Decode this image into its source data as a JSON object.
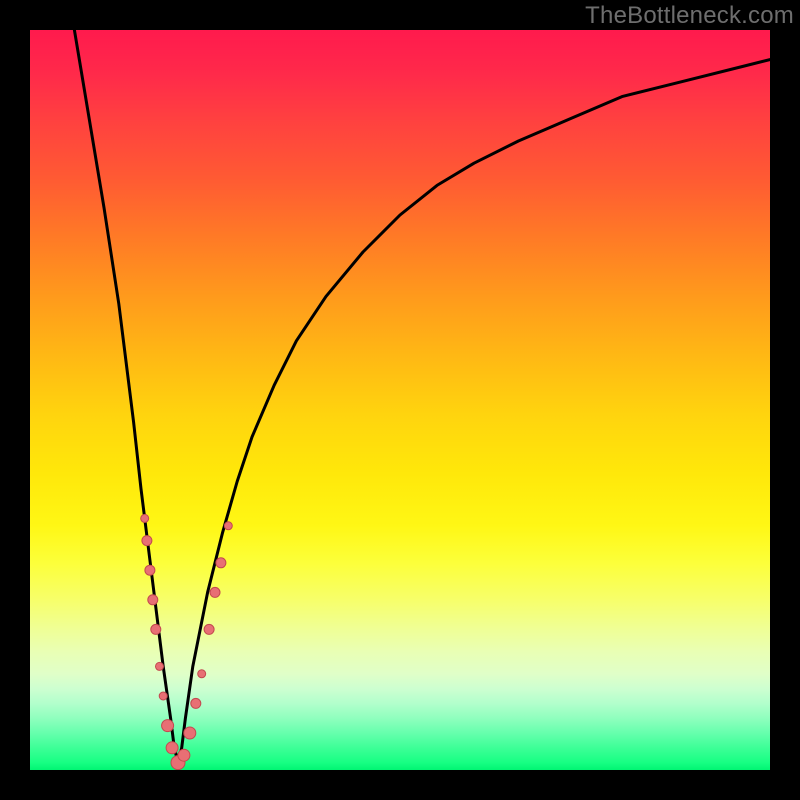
{
  "watermark": "TheBottleneck.com",
  "colors": {
    "curve_stroke": "#000000",
    "point_fill": "#e86f74",
    "point_stroke": "#c3494f"
  },
  "chart_data": {
    "type": "line",
    "title": "",
    "xlabel": "",
    "ylabel": "",
    "xlim": [
      0,
      100
    ],
    "ylim": [
      0,
      100
    ],
    "grid": false,
    "legend": false,
    "series": [
      {
        "name": "bottleneck-curve",
        "x": [
          6,
          8,
          10,
          12,
          14,
          15,
          16,
          17,
          18,
          19,
          19.5,
          20,
          20.5,
          21,
          22,
          24,
          26,
          28,
          30,
          33,
          36,
          40,
          45,
          50,
          55,
          60,
          66,
          73,
          80,
          88,
          96,
          100
        ],
        "y": [
          100,
          88,
          76,
          63,
          47,
          38,
          30,
          22,
          14,
          7,
          3,
          1,
          3,
          7,
          14,
          24,
          32,
          39,
          45,
          52,
          58,
          64,
          70,
          75,
          79,
          82,
          85,
          88,
          91,
          93,
          95,
          96
        ]
      }
    ],
    "points": [
      {
        "x": 15.5,
        "y": 34,
        "r": 4
      },
      {
        "x": 15.8,
        "y": 31,
        "r": 5
      },
      {
        "x": 16.2,
        "y": 27,
        "r": 5
      },
      {
        "x": 16.6,
        "y": 23,
        "r": 5
      },
      {
        "x": 17.0,
        "y": 19,
        "r": 5
      },
      {
        "x": 17.5,
        "y": 14,
        "r": 4
      },
      {
        "x": 18.0,
        "y": 10,
        "r": 4
      },
      {
        "x": 18.6,
        "y": 6,
        "r": 6
      },
      {
        "x": 19.2,
        "y": 3,
        "r": 6
      },
      {
        "x": 20.0,
        "y": 1,
        "r": 7
      },
      {
        "x": 20.8,
        "y": 2,
        "r": 6
      },
      {
        "x": 21.6,
        "y": 5,
        "r": 6
      },
      {
        "x": 22.4,
        "y": 9,
        "r": 5
      },
      {
        "x": 23.2,
        "y": 13,
        "r": 4
      },
      {
        "x": 24.2,
        "y": 19,
        "r": 5
      },
      {
        "x": 25.0,
        "y": 24,
        "r": 5
      },
      {
        "x": 25.8,
        "y": 28,
        "r": 5
      },
      {
        "x": 26.8,
        "y": 33,
        "r": 4
      }
    ]
  }
}
